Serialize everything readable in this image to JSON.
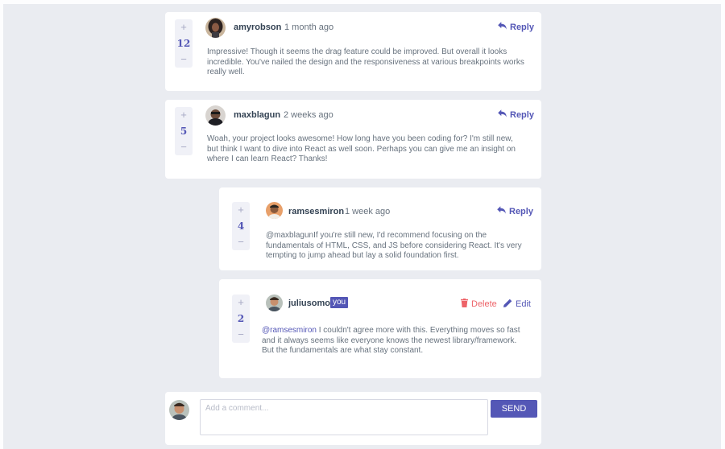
{
  "comments": [
    {
      "score": "12",
      "username": "amyrobson",
      "time": "1 month ago",
      "action": "Reply",
      "body": "Impressive! Though it seems the drag feature could be improved. But overall it looks incredible. You've nailed the design and the responsiveness at various breakpoints works really well."
    },
    {
      "score": "5",
      "username": "maxblagun",
      "time": "2 weeks ago",
      "action": "Reply",
      "body": "Woah, your project looks awesome! How long have you been coding for? I'm still new, but think I want to dive into React as well soon. Perhaps you can give me an insight on where I can learn React? Thanks!"
    }
  ],
  "replies": [
    {
      "score": "4",
      "username": "ramsesmiron",
      "time": "1 week ago",
      "action": "Reply",
      "mention": "@maxblagun",
      "body": "If you're still new, I'd recommend focusing on the fundamentals of HTML, CSS, and JS before considering React. It's very tempting to jump ahead but lay a solid foundation first."
    },
    {
      "score": "2",
      "username": "juliusomo",
      "badge": "you",
      "delete_label": "Delete",
      "edit_label": "Edit",
      "mention": "@ramsesmiron",
      "body": " I couldn't agree more with this. Everything moves so fast and it always seems like everyone knows the newest library/framework. But the fundamentals are what stay constant."
    }
  ],
  "vote": {
    "plus": "+",
    "minus": "−"
  },
  "composer": {
    "placeholder": "Add a comment...",
    "send_label": "SEND"
  },
  "colors": {
    "primary": "#5457b6",
    "danger": "#ed6368",
    "background": "#eaecf1",
    "card": "#ffffff",
    "username": "#334253"
  }
}
